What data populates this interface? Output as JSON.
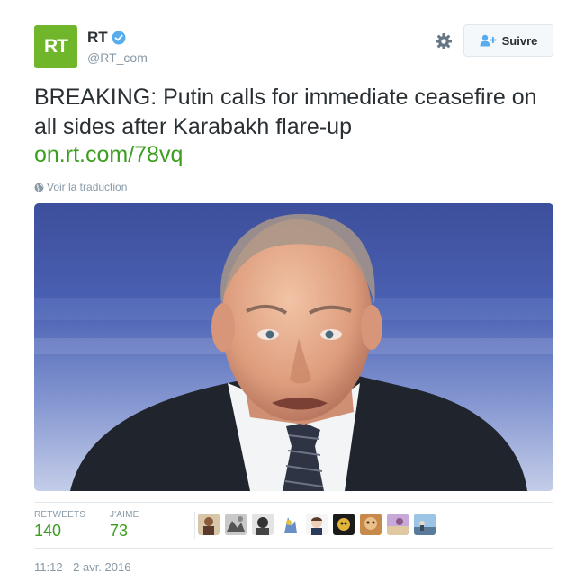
{
  "account": {
    "avatar_text": "RT",
    "name": "RT",
    "handle": "@RT_com",
    "verified": true,
    "brand_color": "#70b62b"
  },
  "header": {
    "settings_icon": "gear-icon",
    "follow_label": "Suivre"
  },
  "tweet": {
    "text": "BREAKING: Putin calls for immediate ceasefire on all sides after Karabakh flare-up",
    "link": "on.rt.com/78vq",
    "link_color": "#3b9e1f",
    "translate_label": "Voir la traduction",
    "timestamp": "11:12 - 2 avr. 2016"
  },
  "stats": {
    "retweets_label": "RETWEETS",
    "retweets_count": "140",
    "likes_label": "J'AIME",
    "likes_count": "73",
    "likers_count_shown": 9
  }
}
